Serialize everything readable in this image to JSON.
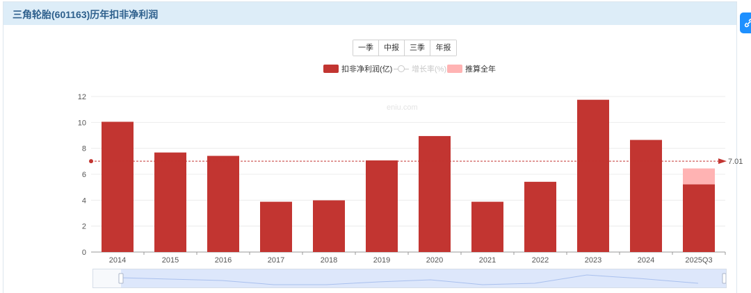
{
  "header": {
    "title": "三角轮胎(601163)历年扣非净利润"
  },
  "buttons": [
    "一季",
    "中报",
    "三季",
    "年报"
  ],
  "legend": {
    "bar": "扣非净利润(亿)",
    "line": "增长率(%)",
    "estimate": "推算全年"
  },
  "watermark": "eniu.com",
  "colors": {
    "bar": "#c23531",
    "estimate": "#ffb3b3",
    "avg_line": "#c23531",
    "header_bg": "#ddedf8"
  },
  "icons": {
    "side_tab": "link-icon"
  },
  "chart_data": {
    "type": "bar",
    "categories": [
      "2014",
      "2015",
      "2016",
      "2017",
      "2018",
      "2019",
      "2020",
      "2021",
      "2022",
      "2023",
      "2024",
      "2025Q3"
    ],
    "series": [
      {
        "name": "扣非净利润(亿)",
        "values": [
          10.05,
          7.68,
          7.42,
          3.88,
          3.99,
          7.07,
          8.95,
          3.88,
          5.42,
          11.75,
          8.65,
          5.22
        ]
      },
      {
        "name": "推算全年",
        "values": [
          null,
          null,
          null,
          null,
          null,
          null,
          null,
          null,
          null,
          null,
          null,
          6.45
        ]
      }
    ],
    "average_line": {
      "value": 7.01,
      "label": "7.01"
    },
    "y_ticks": [
      0,
      2,
      4,
      6,
      8,
      10,
      12
    ],
    "ylim": [
      0,
      12
    ],
    "grid": true,
    "legend_position": "top-center"
  }
}
